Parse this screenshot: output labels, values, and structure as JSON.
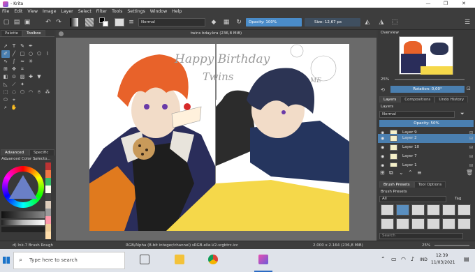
{
  "window": {
    "title": "- Krita",
    "controls": [
      "—",
      "❐",
      "✕"
    ]
  },
  "menu": [
    "File",
    "Edit",
    "View",
    "Image",
    "Layer",
    "Select",
    "Filter",
    "Tools",
    "Settings",
    "Window",
    "Help"
  ],
  "toolbar": {
    "blend_mode": "Normal",
    "opacity": "Opacity: 100%",
    "size": "Size: 12,67 px"
  },
  "left_dock": {
    "tabs": [
      "Palette",
      "Toolbox"
    ],
    "bottom_tabs": [
      "Advanced ...",
      "Specific ..."
    ],
    "color_selector_title": "Advanced Color Selecto..."
  },
  "document": {
    "tab_title": "twins bday.kra (236,8 MiB)",
    "artwork_text": {
      "birthday_line_1": "Happy Birthday",
      "birthday_line_2": "Twins",
      "me_note": "ME"
    }
  },
  "right_dock": {
    "overview_title": "Overview",
    "zoom_value": "25%",
    "rotation": "Rotation: 0,00°",
    "tabs": [
      "Layers",
      "Compositions",
      "Undo History"
    ],
    "layers_title": "Layers",
    "blend_mode": "Normal",
    "opacity": "Opacity: 50%",
    "layers": [
      {
        "name": "Layer 9",
        "active": false
      },
      {
        "name": "Layer 2",
        "active": true
      },
      {
        "name": "Layer 10",
        "active": false
      },
      {
        "name": "Layer 7",
        "active": false
      },
      {
        "name": "Layer 1",
        "active": false
      }
    ],
    "brush_tabs": [
      "Brush Presets",
      "Tool Options"
    ],
    "brush_presets_title": "Brush Presets",
    "brush_filter": "All",
    "tag_label": "Tag",
    "search_placeholder": "Search"
  },
  "statusbar": {
    "brush_name": "d) Ink-7 Brush Rough",
    "color_info": "RGB/Alpha (8-bit integer/channel)  sRGB-elle-V2-srgbtrc.icc",
    "dimensions": "2.000 x 2.164 (236,8 MiB)",
    "zoom": "25%"
  },
  "taskbar": {
    "search_placeholder": "Type here to search",
    "language": "IND",
    "time": "12:39",
    "date": "11/03/2021"
  },
  "colors": {
    "accent": "#4a7fb0",
    "panel_bg": "#393939",
    "canvas_bg": "#6a6a6a"
  }
}
